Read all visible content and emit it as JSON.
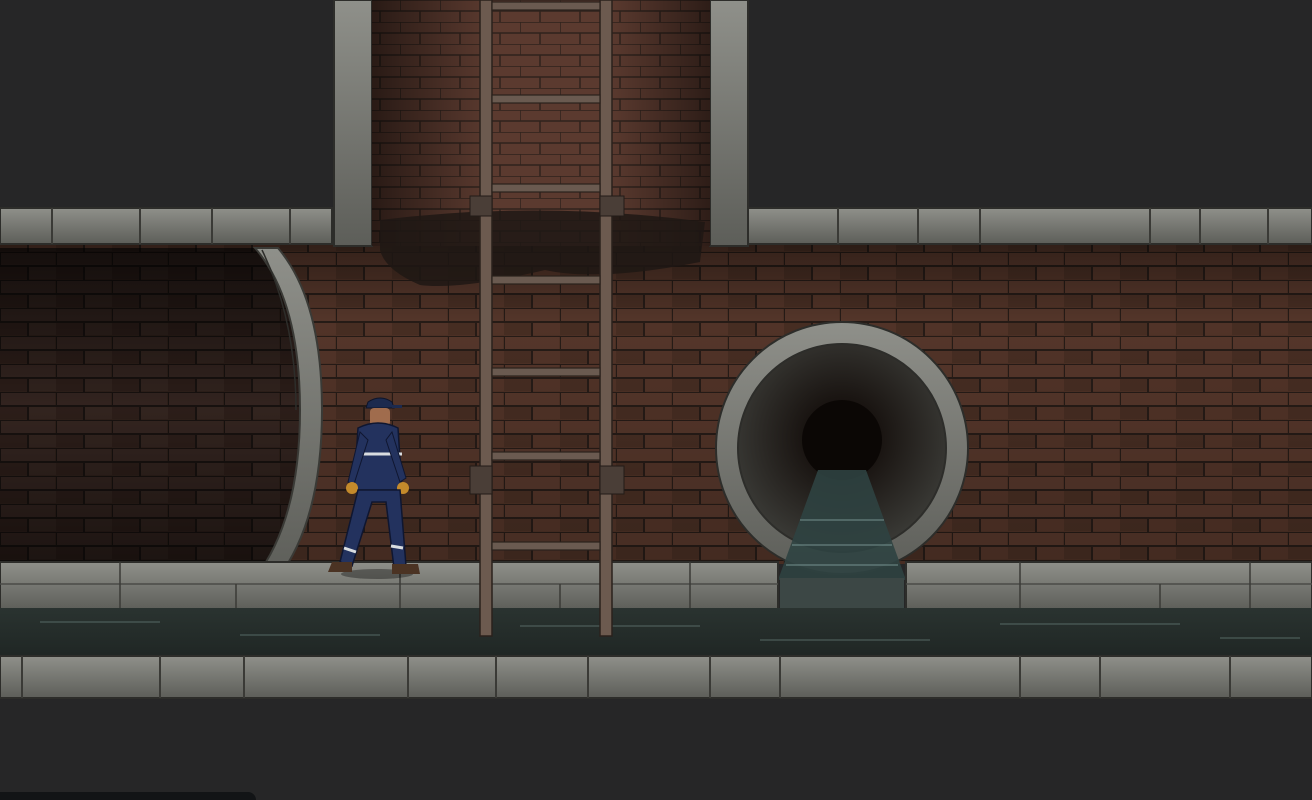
{
  "scene": {
    "type": "side-scrolling sewer level",
    "colors": {
      "void": "#262627",
      "brick": "#5a3a2e",
      "brick_dark": "#3e2920",
      "mortar": "#2b201b",
      "stone": "#8a8a84",
      "stone_dark": "#5f605c",
      "water": "#27302d",
      "ladder": "#6c5a4f",
      "uniform": "#23325e",
      "reflective_stripe": "#d9dde0"
    },
    "icons": {
      "player": "worker-in-overalls",
      "ladder": "rusty-ladder",
      "drain": "round-drain-pipe-outlet",
      "tunnel": "curved-brick-tunnel"
    }
  }
}
